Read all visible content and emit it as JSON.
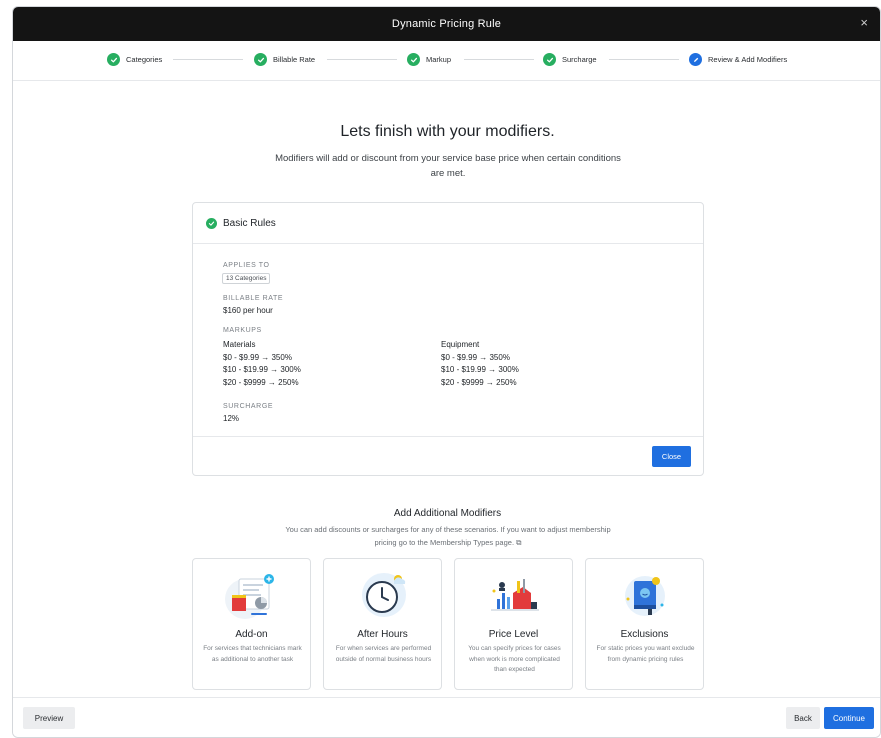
{
  "window": {
    "title": "Dynamic Pricing Rule",
    "close_glyph": "×"
  },
  "steps": [
    {
      "label": "Categories",
      "state": "complete",
      "icon": "check-icon"
    },
    {
      "label": "Billable Rate",
      "state": "complete",
      "icon": "check-icon"
    },
    {
      "label": "Markup",
      "state": "complete",
      "icon": "check-icon"
    },
    {
      "label": "Surcharge",
      "state": "complete",
      "icon": "check-icon"
    },
    {
      "label": "Review & Add Modifiers",
      "state": "current",
      "icon": "pencil-icon"
    }
  ],
  "hero": {
    "title": "Lets finish with your modifiers.",
    "subtitle": "Modifiers will add or discount from your service base price when certain conditions are met."
  },
  "basic_rules": {
    "title": "Basic Rules",
    "applies_to_label": "APPLIES TO",
    "applies_to_value": "13 Categories",
    "billable_rate_label": "BILLABLE RATE",
    "billable_rate_value": "$160 per hour",
    "markups_label": "MARKUPS",
    "materials": {
      "name": "Materials",
      "tiers": [
        "$0 - $9.99 → 350%",
        "$10 - $19.99 → 300%",
        "$20 - $9999 → 250%"
      ]
    },
    "equipment": {
      "name": "Equipment",
      "tiers": [
        "$0 - $9.99 → 350%",
        "$10 - $19.99 → 300%",
        "$20 - $9999 → 250%"
      ]
    },
    "surcharge_label": "SURCHARGE",
    "surcharge_value": "12%",
    "close_label": "Close"
  },
  "modifiers": {
    "title": "Add Additional Modifiers",
    "subtitle": "You can add discounts or surcharges for any of these scenarios. If you want to adjust membership pricing go to the Membership Types page.",
    "external_glyph": "⧉",
    "cards": [
      {
        "name": "Add-on",
        "desc": "For services that technicians mark as additional to another task"
      },
      {
        "name": "After Hours",
        "desc": "For when services are performed outside of normal business hours"
      },
      {
        "name": "Price Level",
        "desc": "You can specify prices for cases when work is more complicated than expected"
      },
      {
        "name": "Exclusions",
        "desc": "For static prices you want exclude from dynamic pricing rules"
      }
    ]
  },
  "footer": {
    "preview_label": "Preview",
    "back_label": "Back",
    "continue_label": "Continue"
  },
  "colors": {
    "success": "#27ae60",
    "primary": "#1f6fe0",
    "topbar": "#141414"
  }
}
